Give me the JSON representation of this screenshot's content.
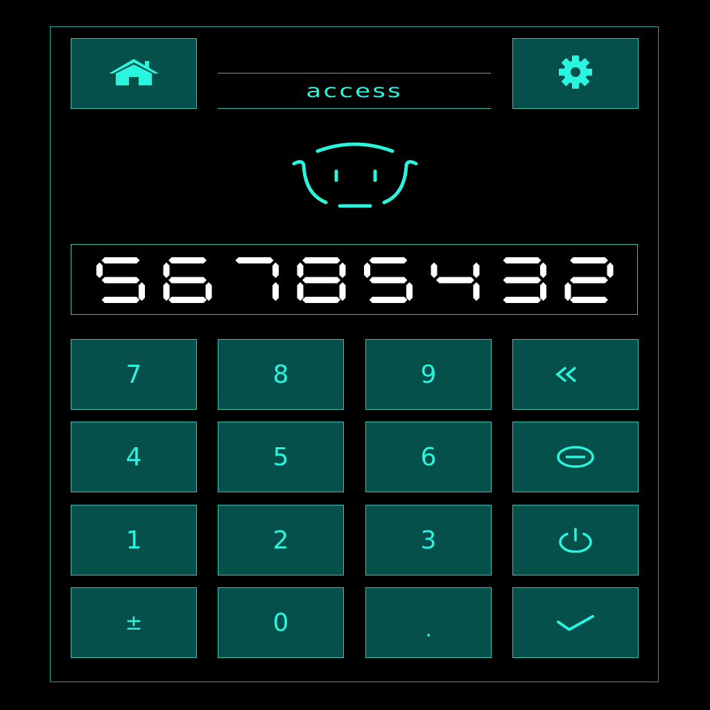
{
  "header": {
    "title": "access",
    "home_icon": "home-icon",
    "settings_icon": "gear-icon"
  },
  "mascot_icon": "face-icon",
  "display": {
    "value": "56785432"
  },
  "keypad": {
    "rows": [
      [
        {
          "label": "7"
        },
        {
          "label": "8"
        },
        {
          "label": "9"
        },
        {
          "label": "",
          "icon": "backspace-icon"
        }
      ],
      [
        {
          "label": "4"
        },
        {
          "label": "5"
        },
        {
          "label": "6"
        },
        {
          "label": "",
          "icon": "minus-circle-icon"
        }
      ],
      [
        {
          "label": "1"
        },
        {
          "label": "2"
        },
        {
          "label": "3"
        },
        {
          "label": "",
          "icon": "power-icon"
        }
      ],
      [
        {
          "label": "±"
        },
        {
          "label": "0"
        },
        {
          "label": "."
        },
        {
          "label": "",
          "icon": "check-icon"
        }
      ]
    ]
  },
  "colors": {
    "accent": "#2af5df",
    "tile": "#06504c",
    "border": "#36c2b4",
    "background": "#000000",
    "display_text": "#ffffff"
  }
}
